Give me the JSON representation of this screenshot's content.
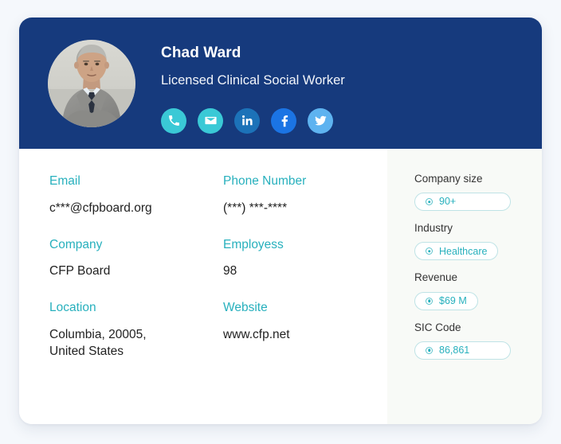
{
  "colors": {
    "page_background": "#f5f8fc",
    "header_navy": "#163a7d",
    "label_teal": "#27b0bd",
    "chip_border": "#bfe3e6",
    "side_panel_background": "#f8faf7",
    "card_white": "#ffffff"
  },
  "header": {
    "name": "Chad Ward",
    "title": "Licensed Clinical Social Worker",
    "avatar_alt": "profile-photo",
    "socials": [
      {
        "name": "phone-icon",
        "label": "Phone",
        "color": "#3ac9d6"
      },
      {
        "name": "email-icon",
        "label": "Email",
        "color": "#3ac9d6"
      },
      {
        "name": "linkedin-icon",
        "label": "LinkedIn",
        "color": "#1c72b8"
      },
      {
        "name": "facebook-icon",
        "label": "Facebook",
        "color": "#1b74e4"
      },
      {
        "name": "twitter-icon",
        "label": "Twitter",
        "color": "#5eb3f0"
      }
    ]
  },
  "details": [
    {
      "label": "Email",
      "value": "c***@cfpboard.org"
    },
    {
      "label": "Phone Number",
      "value": "(***) ***-****"
    },
    {
      "label": "Company",
      "value": "CFP Board"
    },
    {
      "label": "Employess",
      "value": "98"
    },
    {
      "label": "Location",
      "value": "Columbia, 20005, United States"
    },
    {
      "label": "Website",
      "value": "www.cfp.net"
    }
  ],
  "side_panel": [
    {
      "label": "Company size",
      "value": "90+",
      "wide": true
    },
    {
      "label": "Industry",
      "value": "Healthcare",
      "wide": false
    },
    {
      "label": "Revenue",
      "value": "$69 M",
      "wide": false
    },
    {
      "label": "SIC Code",
      "value": "86,861",
      "wide": true
    }
  ]
}
